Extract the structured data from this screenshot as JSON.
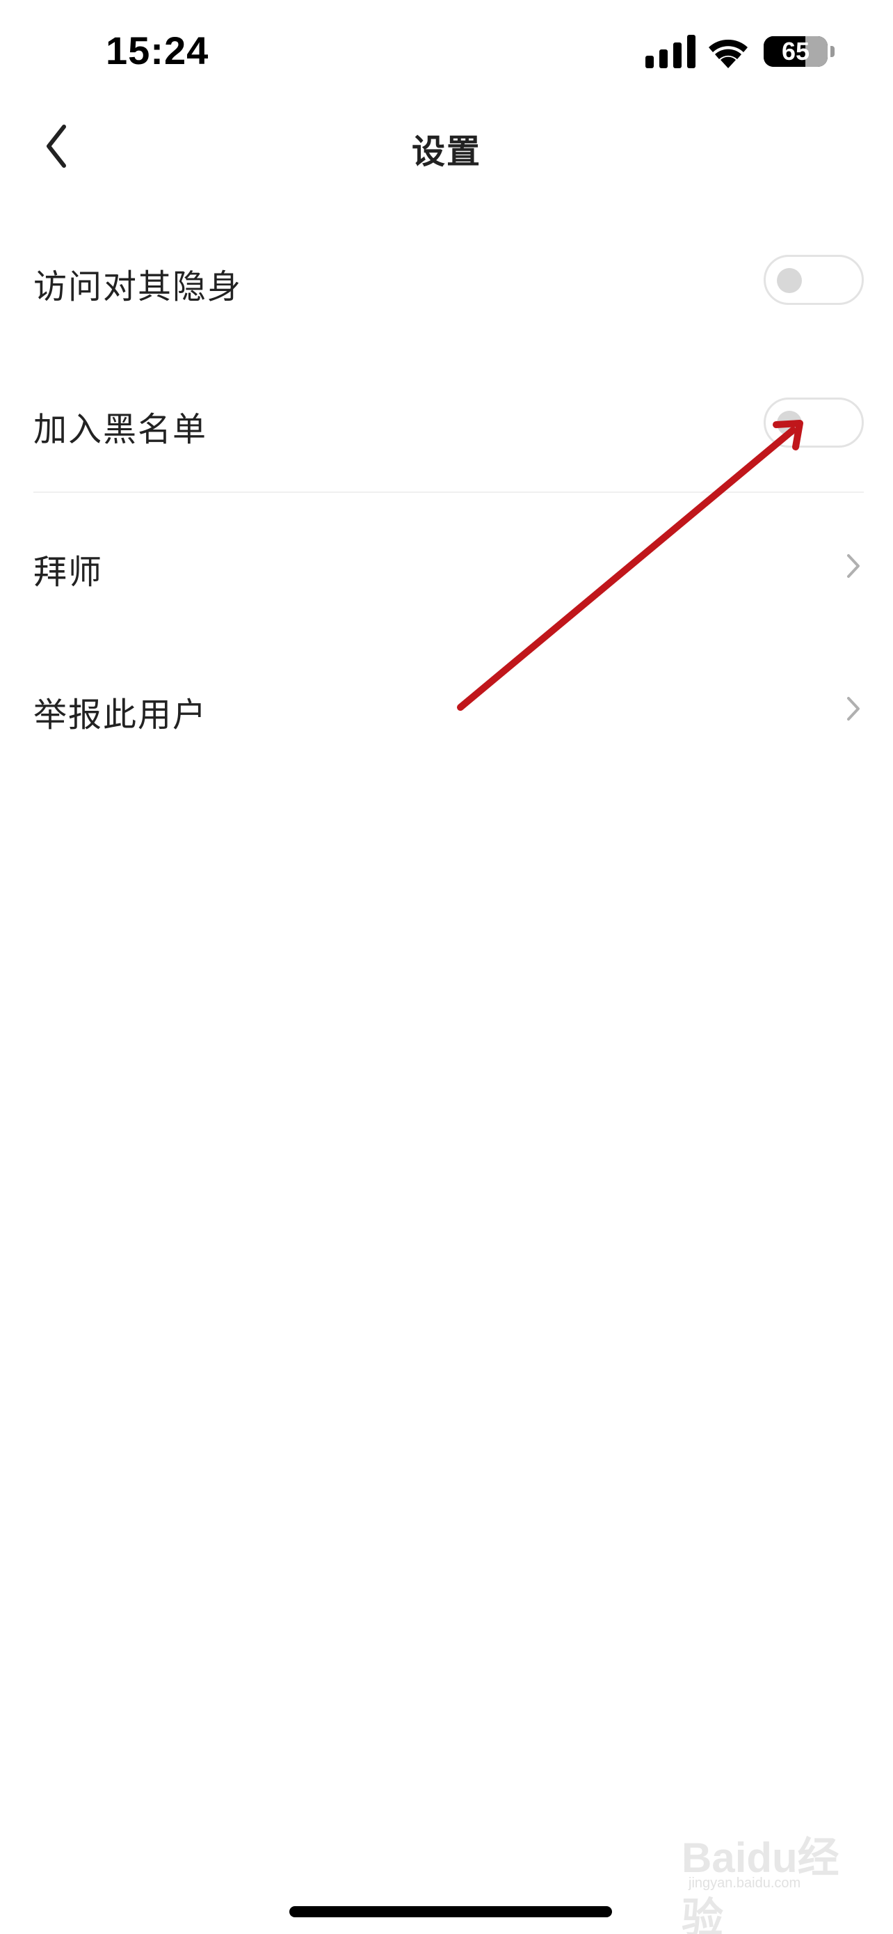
{
  "status_bar": {
    "time": "15:24",
    "battery_level": "65",
    "battery_fraction": 0.65,
    "icons": [
      "signal-icon",
      "wifi-icon",
      "battery-icon"
    ]
  },
  "header": {
    "title": "设置",
    "back_icon": "chevron-left-icon"
  },
  "settings": {
    "items": [
      {
        "label": "访问对其隐身",
        "control": "toggle",
        "on": false
      },
      {
        "label": "加入黑名单",
        "control": "toggle",
        "on": false
      },
      {
        "label": "拜师",
        "control": "chevron"
      },
      {
        "label": "举报此用户",
        "control": "chevron"
      }
    ]
  },
  "annotation": {
    "type": "arrow",
    "color": "#c0161b",
    "points_to": "加入黑名单 toggle"
  },
  "watermark": {
    "logo": "Baidu经验",
    "url": "jingyan.baidu.com"
  },
  "colors": {
    "text": "#222222",
    "toggle_border": "#e3e3e3",
    "toggle_knob": "#d8d8d8",
    "chevron": "#b0b0b0",
    "arrow": "#c0161b"
  }
}
